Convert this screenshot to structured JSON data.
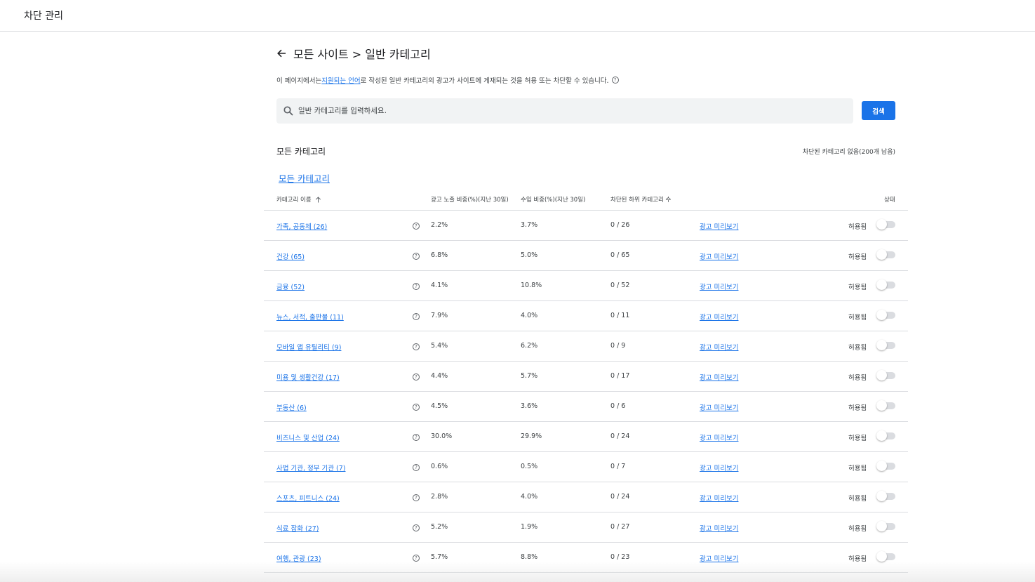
{
  "app": {
    "title": "차단 관리"
  },
  "heading": {
    "text": "모든 사이트 > 일반 카테고리"
  },
  "description": {
    "before": "이 페이지에서는 ",
    "link": "지원되는 언어",
    "after": "로 작성된 일반 카테고리의 광고가 사이트에 게재되는 것을 허용 또는 차단할 수 있습니다."
  },
  "search": {
    "placeholder": "일반 카테고리를 입력하세요.",
    "button_label": "검색"
  },
  "section": {
    "title": "모든 카테고리",
    "blocked_info": "차단된 카테고리 없음(200개 남음)",
    "breadcrumb": "모든 카테고리"
  },
  "columns": {
    "name": "카테고리 이름",
    "impressions": "광고 노출 비중(%)(지난 30일)",
    "revenue": "수입 비중(%)(지난 30일)",
    "blocked_sub": "차단된 하위 카테고리 수",
    "status": "상태"
  },
  "rows": [
    {
      "name": "가족, 공동체 (26)",
      "impressions": "2.2%",
      "revenue": "3.7%",
      "blocked": "0 / 26",
      "preview": "광고 미리보기",
      "status": "허용됨"
    },
    {
      "name": "건강 (65)",
      "impressions": "6.8%",
      "revenue": "5.0%",
      "blocked": "0 / 65",
      "preview": "광고 미리보기",
      "status": "허용됨"
    },
    {
      "name": "금융 (52)",
      "impressions": "4.1%",
      "revenue": "10.8%",
      "blocked": "0 / 52",
      "preview": "광고 미리보기",
      "status": "허용됨"
    },
    {
      "name": "뉴스, 서적, 출판물 (11)",
      "impressions": "7.9%",
      "revenue": "4.0%",
      "blocked": "0 / 11",
      "preview": "광고 미리보기",
      "status": "허용됨"
    },
    {
      "name": "모바일 앱 유틸리티 (9)",
      "impressions": "5.4%",
      "revenue": "6.2%",
      "blocked": "0 / 9",
      "preview": "광고 미리보기",
      "status": "허용됨"
    },
    {
      "name": "미용 및 생활건강 (17)",
      "impressions": "4.4%",
      "revenue": "5.7%",
      "blocked": "0 / 17",
      "preview": "광고 미리보기",
      "status": "허용됨"
    },
    {
      "name": "부동산 (6)",
      "impressions": "4.5%",
      "revenue": "3.6%",
      "blocked": "0 / 6",
      "preview": "광고 미리보기",
      "status": "허용됨"
    },
    {
      "name": "비즈니스 및 산업 (24)",
      "impressions": "30.0%",
      "revenue": "29.9%",
      "blocked": "0 / 24",
      "preview": "광고 미리보기",
      "status": "허용됨"
    },
    {
      "name": "사법 기관, 정부 기관 (7)",
      "impressions": "0.6%",
      "revenue": "0.5%",
      "blocked": "0 / 7",
      "preview": "광고 미리보기",
      "status": "허용됨"
    },
    {
      "name": "스포츠, 피트니스 (24)",
      "impressions": "2.8%",
      "revenue": "4.0%",
      "blocked": "0 / 24",
      "preview": "광고 미리보기",
      "status": "허용됨"
    },
    {
      "name": "식료 잡화 (27)",
      "impressions": "5.2%",
      "revenue": "1.9%",
      "blocked": "0 / 27",
      "preview": "광고 미리보기",
      "status": "허용됨"
    },
    {
      "name": "여행, 관광 (23)",
      "impressions": "5.7%",
      "revenue": "8.8%",
      "blocked": "0 / 23",
      "preview": "광고 미리보기",
      "status": "허용됨"
    }
  ],
  "icons": {
    "back": "arrow-left-icon",
    "search": "search-icon",
    "help": "help-circle-icon",
    "sort": "arrow-up-icon"
  },
  "colors": {
    "accent": "#1a73e8",
    "toggle_off": "#dadce0"
  }
}
